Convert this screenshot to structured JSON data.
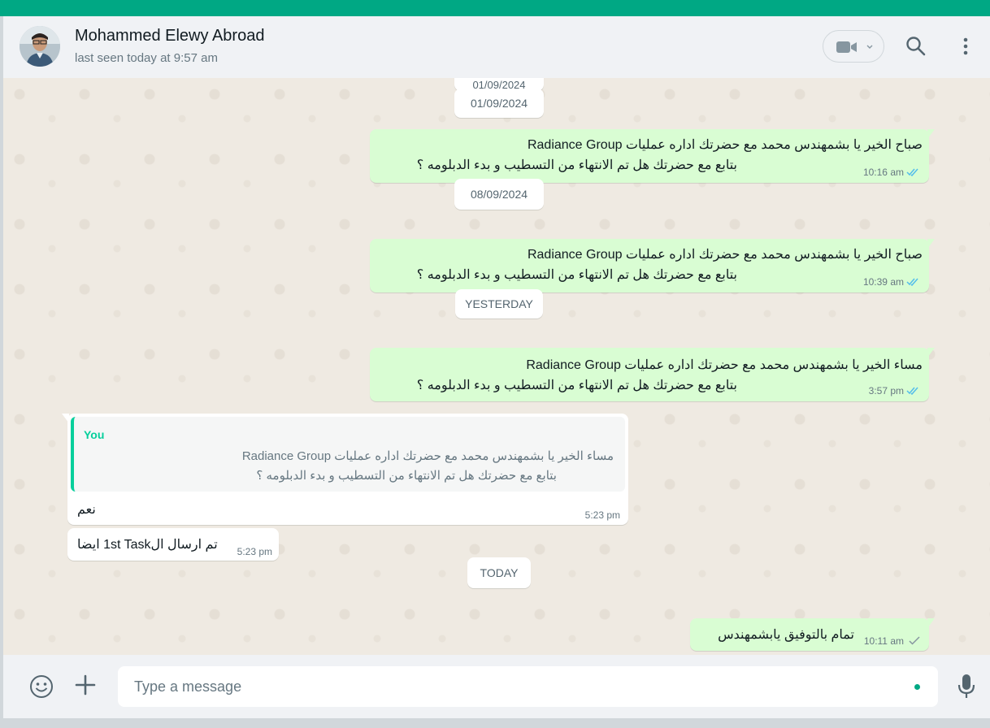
{
  "header": {
    "contact_name": "Mohammed Elewy Abroad",
    "status": "last seen today at 9:57 am"
  },
  "dates": {
    "d0_partial": "01/09/2024",
    "d1": "01/09/2024",
    "d2": "08/09/2024",
    "d3": "YESTERDAY",
    "d4": "TODAY"
  },
  "messages": [
    {
      "line1": "صباح الخير يا بشمهندس محمد مع  حضرتك اداره عمليات Radiance Group",
      "line2": "بتابع مع حضرتك هل تم الانتهاء من التسطيب و بدء الدبلومه ؟",
      "time": "10:16 am"
    },
    {
      "line1": "صباح الخير يا بشمهندس محمد مع  حضرتك اداره عمليات Radiance Group",
      "line2": "بتابع مع حضرتك هل تم الانتهاء من التسطيب و بدء الدبلومه ؟",
      "time": "10:39 am"
    },
    {
      "line1": "مساء الخير يا بشمهندس محمد مع  حضرتك اداره عمليات Radiance Group",
      "line2": "بتابع مع حضرتك هل تم الانتهاء من التسطيب و بدء الدبلومه ؟",
      "time": "3:57 pm"
    },
    {
      "quote_author": "You",
      "quote_line1": "مساء الخير يا بشمهندس محمد مع  حضرتك اداره عمليات Radiance Group",
      "quote_line2": "بتابع مع حضرتك هل تم الانتهاء من التسطيب و بدء الدبلومه ؟",
      "text": "نعم",
      "time": "5:23 pm"
    },
    {
      "text": "تم ارسال ال1st Task ايضا",
      "time": "5:23 pm"
    },
    {
      "text": "تمام بالتوفيق يابشمهندس",
      "time": "10:11 am"
    }
  ],
  "composer": {
    "placeholder": "Type a message"
  },
  "colors": {
    "accent": "#00a884",
    "outgoing_bubble": "#d9fdd3",
    "incoming_bubble": "#ffffff",
    "read_tick": "#53bdeb"
  },
  "icons": [
    "video-call-icon",
    "chevron-down-icon",
    "search-icon",
    "menu-icon",
    "double-tick-icon",
    "single-tick-icon",
    "emoji-icon",
    "plus-icon",
    "microphone-icon"
  ]
}
